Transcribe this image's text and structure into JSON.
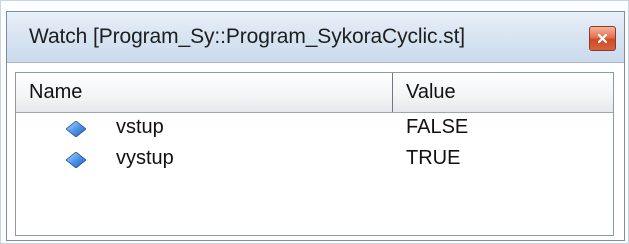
{
  "window": {
    "title": "Watch [Program_Sy::Program_SykoraCyclic.st]"
  },
  "columns": {
    "name": "Name",
    "value": "Value"
  },
  "rows": [
    {
      "name": "vstup",
      "value": "FALSE",
      "icon": "variable-diamond-icon"
    },
    {
      "name": "vystup",
      "value": "TRUE",
      "icon": "variable-diamond-icon"
    }
  ],
  "colors": {
    "title_gradient_top": "#e9f0f8",
    "title_gradient_bottom": "#cadbed",
    "close_button": "#d9633f",
    "icon_blue": "#3c7fd8"
  }
}
